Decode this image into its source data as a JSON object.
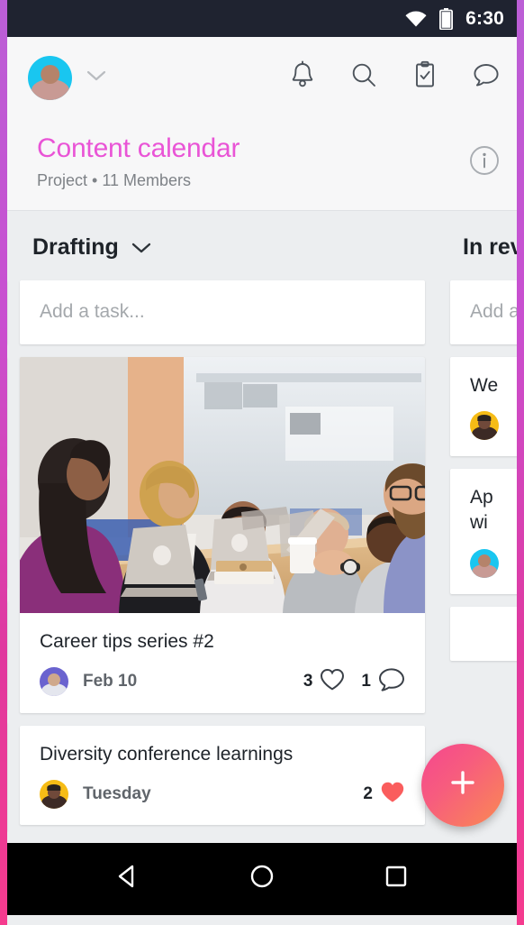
{
  "status_bar": {
    "time": "6:30",
    "wifi_icon": "wifi-icon",
    "battery_icon": "battery-icon"
  },
  "app_bar": {
    "account_chevron": "chevron-down-icon",
    "icons": [
      {
        "name": "notifications-icon",
        "label": "Notifications"
      },
      {
        "name": "search-icon",
        "label": "Search"
      },
      {
        "name": "tasks-icon",
        "label": "My Tasks"
      },
      {
        "name": "messages-icon",
        "label": "Messages"
      }
    ]
  },
  "project_header": {
    "title": "Content calendar",
    "subtitle": "Project • 11 Members",
    "info_icon": "info-icon",
    "title_color": "#e954d6"
  },
  "board": {
    "columns": [
      {
        "name": "peek-left",
        "title": "",
        "add_task_placeholder": "",
        "cards": [
          {
            "title": "",
            "date": "",
            "likes": "",
            "comments": ""
          },
          {
            "title": "",
            "date": "",
            "likes": "",
            "comments": ""
          },
          {
            "title": "",
            "date": "",
            "likes": "",
            "comments": ""
          },
          {
            "title": "",
            "date": "",
            "likes": "",
            "comments": ""
          }
        ]
      },
      {
        "name": "drafting",
        "title": "Drafting",
        "chevron": "chevron-down-icon",
        "add_task_placeholder": "Add a task...",
        "cards": [
          {
            "title": "Career tips series #2",
            "date": "Feb 10",
            "likes": "3",
            "comments": "1",
            "liked": false,
            "has_photo": true,
            "photo_alt": "team meeting around a table with laptops",
            "avatar_color": "#6a63cf"
          },
          {
            "title": "Diversity conference learnings",
            "date": "Tuesday",
            "likes": "2",
            "comments": "",
            "liked": true,
            "has_photo": false,
            "avatar_color": "#f6bc16"
          }
        ]
      },
      {
        "name": "in-review",
        "title": "In review",
        "title_truncated": "In r",
        "chevron": "chevron-down-icon",
        "add_task_placeholder": "Add a task...",
        "add_task_truncated": "Ad",
        "cards": [
          {
            "title_truncated": "We",
            "avatar_color": "#f6bc16"
          },
          {
            "title_truncated_line1": "Ap",
            "title_truncated_line2": "wi",
            "avatar_color": "#19c6f0"
          }
        ]
      }
    ]
  },
  "fab": {
    "icon": "plus-icon",
    "label": "Create task",
    "gradient_from": "#f5478f",
    "gradient_to": "#fa8a52"
  },
  "nav_bar": {
    "buttons": [
      {
        "name": "back-button",
        "icon": "triangle-left-icon"
      },
      {
        "name": "home-button",
        "icon": "circle-icon"
      },
      {
        "name": "recents-button",
        "icon": "square-icon"
      }
    ]
  },
  "frame": {
    "gradient_from": "#bb5fd6",
    "gradient_to": "#f53b8e"
  }
}
